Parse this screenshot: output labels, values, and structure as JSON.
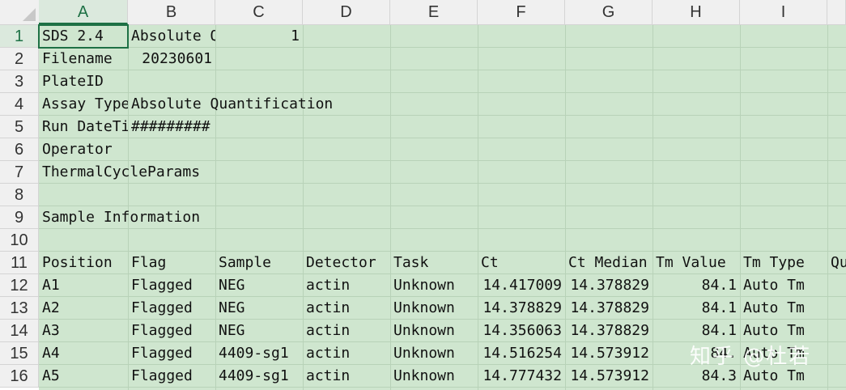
{
  "columns": [
    "A",
    "B",
    "C",
    "D",
    "E",
    "F",
    "G",
    "H",
    "I"
  ],
  "selected_column": "A",
  "row_numbers": [
    "1",
    "2",
    "3",
    "4",
    "5",
    "6",
    "7",
    "8",
    "9",
    "10",
    "11",
    "12",
    "13",
    "14",
    "15",
    "16"
  ],
  "selected_row": "1",
  "header_rows": {
    "r1": {
      "a": "SDS 2.4",
      "b": "Absolute Q",
      "c": "1"
    },
    "r2": {
      "a": "Filename",
      "b": "20230601"
    },
    "r3": {
      "a": "PlateID"
    },
    "r4": {
      "a": "Assay Type",
      "b": "Absolute Quantification"
    },
    "r5": {
      "a": "Run DateTime",
      "b": "#########"
    },
    "r6": {
      "a": "Operator"
    },
    "r7": {
      "a": "ThermalCycleParams"
    },
    "r9": {
      "a": "Sample Information"
    }
  },
  "table": {
    "headers": [
      "Position",
      "Flag",
      "Sample",
      "Detector",
      "Task",
      "Ct",
      "Ct Median",
      "Tm Value",
      "Tm Type",
      "Qu"
    ],
    "rows": [
      [
        "A1",
        "Flagged",
        "NEG",
        "actin",
        "Unknown",
        "14.417009",
        "14.378829",
        "84.1",
        "Auto Tm"
      ],
      [
        "A2",
        "Flagged",
        "NEG",
        "actin",
        "Unknown",
        "14.378829",
        "14.378829",
        "84.1",
        "Auto Tm"
      ],
      [
        "A3",
        "Flagged",
        "NEG",
        "actin",
        "Unknown",
        "14.356063",
        "14.378829",
        "84.1",
        "Auto Tm"
      ],
      [
        "A4",
        "Flagged",
        "4409-sg1",
        "actin",
        "Unknown",
        "14.516254",
        "14.573912",
        "84.",
        "Auto Tm"
      ],
      [
        "A5",
        "Flagged",
        "4409-sg1",
        "actin",
        "Unknown",
        "14.777432",
        "14.573912",
        "84.3",
        "Auto Tm"
      ]
    ]
  },
  "watermark": "知乎 @杜若",
  "colors": {
    "cell_fill": "#cfe6cf",
    "accent": "#1e7145",
    "header_bg": "#f0f0f0"
  }
}
